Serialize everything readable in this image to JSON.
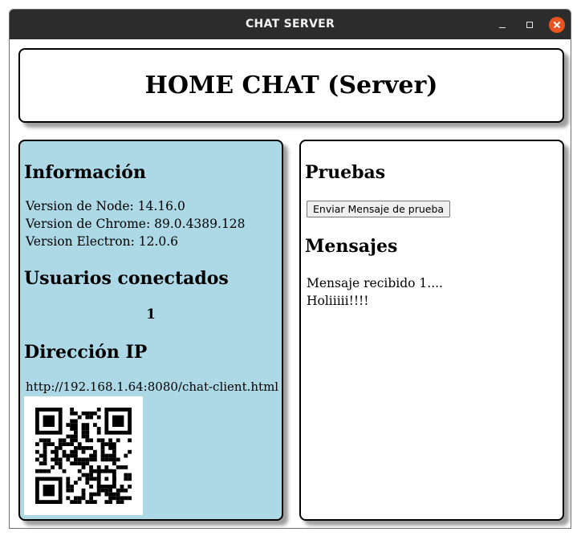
{
  "window": {
    "title": "CHAT SERVER"
  },
  "header": {
    "title": "HOME CHAT (Server)"
  },
  "info": {
    "heading": "Información",
    "node_version": "Version de Node: 14.16.0",
    "chrome_version": "Version de Chrome: 89.0.4389.128",
    "electron_version": "Version Electron: 12.0.6"
  },
  "users": {
    "heading": "Usuarios conectados",
    "count": "1"
  },
  "ip": {
    "heading": "Dirección IP",
    "url": "http://192.168.1.64:8080/chat-client.html"
  },
  "tests": {
    "heading": "Pruebas",
    "button_label": "Enviar Mensaje de prueba"
  },
  "messages": {
    "heading": "Mensajes",
    "items": [
      "Mensaje recibido 1....",
      "Holiiiii!!!!"
    ]
  },
  "colors": {
    "left_panel": "#add8e6",
    "close_button": "#e95420",
    "titlebar": "#2c2c2c"
  }
}
